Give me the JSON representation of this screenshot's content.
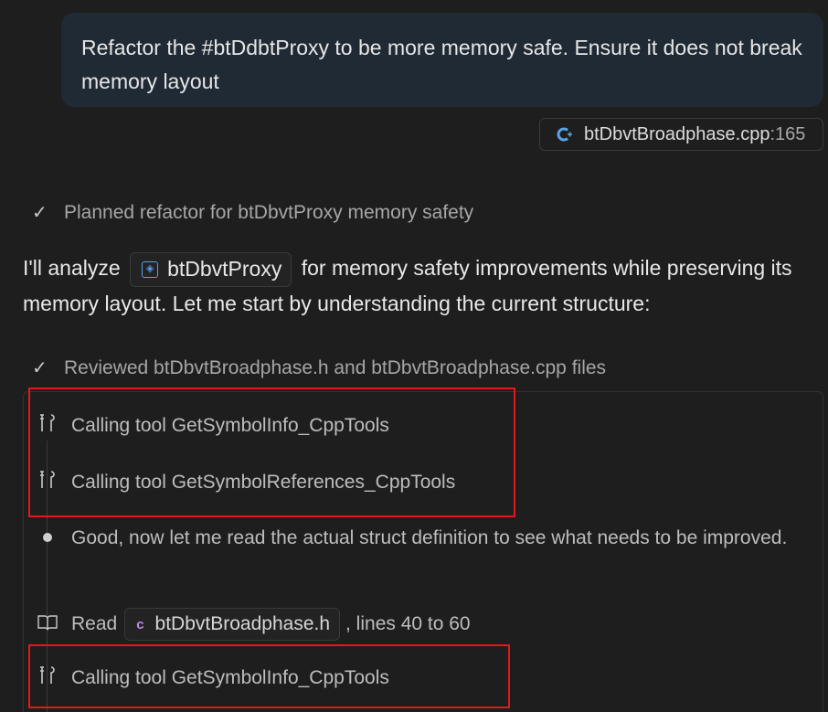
{
  "user_message": {
    "text": "Refactor the #btDdbtProxy to be more memory safe. Ensure it does not break memory layout"
  },
  "context_ref": {
    "icon": "cpp-file-icon",
    "file": "btDbvtBroadphase.cpp",
    "line": ":165"
  },
  "status_planned": "Planned refactor for btDbvtProxy memory safety",
  "assistant_message": {
    "prefix": "I'll analyze",
    "symbol": "btDbvtProxy",
    "suffix": "for memory safety improvements while preserving its memory layout. Let me start by understanding the current structure:"
  },
  "status_reviewed": "Reviewed btDbvtBroadphase.h and btDbvtBroadphase.cpp files",
  "tool_calls": [
    {
      "label": "Calling tool GetSymbolInfo_CppTools",
      "icon": "tools-icon"
    },
    {
      "label": "Calling tool GetSymbolReferences_CppTools",
      "icon": "tools-icon"
    },
    {
      "label": "Calling tool GetSymbolInfo_CppTools",
      "icon": "tools-icon"
    }
  ],
  "thought": "Good, now let me read the actual struct definition to see what needs to be improved.",
  "read_action": {
    "verb": "Read",
    "file": "btDbvtBroadphase.h",
    "file_icon": "c",
    "range": ", lines 40 to 60"
  },
  "colors": {
    "background": "#1e1e1e",
    "user_bubble": "#1f2a35",
    "highlight_box": "#e0191b",
    "symbol_accent": "#5b9ee8"
  }
}
